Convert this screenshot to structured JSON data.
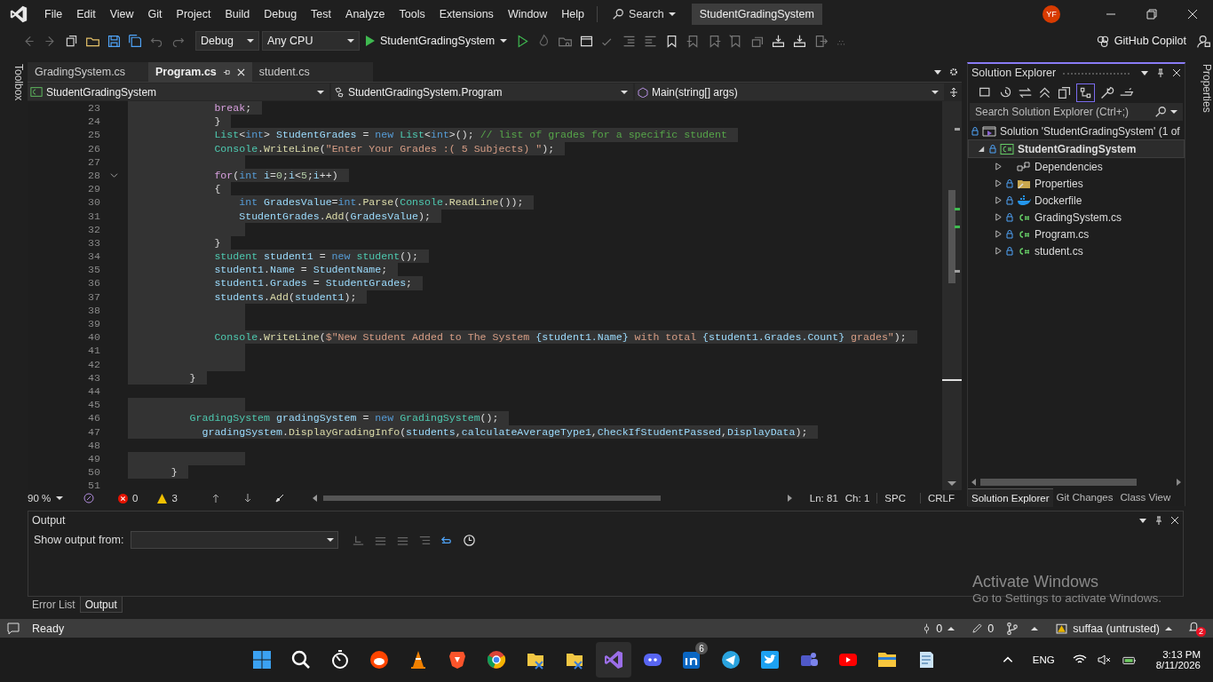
{
  "title_bar": {
    "menu": [
      "File",
      "Edit",
      "View",
      "Git",
      "Project",
      "Build",
      "Debug",
      "Test",
      "Analyze",
      "Tools",
      "Extensions",
      "Window",
      "Help"
    ],
    "search": "Search",
    "solution_title": "StudentGradingSystem",
    "avatar": "YF"
  },
  "toolbar": {
    "configuration": "Debug",
    "platform": "Any CPU",
    "start_target": "StudentGradingSystem",
    "copilot": "GitHub Copilot"
  },
  "side_tabs": {
    "left": "Toolbox",
    "right": "Properties"
  },
  "document_tabs": [
    {
      "label": "GradingSystem.cs",
      "selected": false
    },
    {
      "label": "Program.cs",
      "selected": true
    },
    {
      "label": "student.cs",
      "selected": false
    }
  ],
  "nav_bar": {
    "project": "StudentGradingSystem",
    "type": "StudentGradingSystem.Program",
    "member": "Main(string[] args)"
  },
  "code_lines": [
    {
      "num": "23",
      "fold": false,
      "selected": true,
      "tokens": [
        {
          "kind": "control",
          "text": "              break"
        },
        {
          "kind": "plain",
          "text": ";"
        }
      ]
    },
    {
      "num": "24",
      "fold": false,
      "selected": true,
      "tokens": [
        {
          "kind": "plain",
          "text": "              }"
        }
      ]
    },
    {
      "num": "25",
      "fold": false,
      "selected": true,
      "tokens": [
        {
          "kind": "type",
          "text": "              List"
        },
        {
          "kind": "plain",
          "text": "<"
        },
        {
          "kind": "keyword",
          "text": "int"
        },
        {
          "kind": "plain",
          "text": "> "
        },
        {
          "kind": "variable",
          "text": "StudentGrades"
        },
        {
          "kind": "plain",
          "text": " = "
        },
        {
          "kind": "keyword",
          "text": "new "
        },
        {
          "kind": "type",
          "text": "List"
        },
        {
          "kind": "plain",
          "text": "<"
        },
        {
          "kind": "keyword",
          "text": "int"
        },
        {
          "kind": "plain",
          "text": ">(); "
        },
        {
          "kind": "comment",
          "text": "// list of grades for a specific student"
        }
      ]
    },
    {
      "num": "26",
      "fold": false,
      "selected": true,
      "tokens": [
        {
          "kind": "type",
          "text": "              Console"
        },
        {
          "kind": "plain",
          "text": "."
        },
        {
          "kind": "method",
          "text": "WriteLine"
        },
        {
          "kind": "plain",
          "text": "("
        },
        {
          "kind": "string",
          "text": "\"Enter Your Grades :( 5 Subjects) \""
        },
        {
          "kind": "plain",
          "text": ");"
        }
      ]
    },
    {
      "num": "27",
      "fold": false,
      "selected": true
    },
    {
      "num": "28",
      "fold": true,
      "selected": true,
      "tokens": [
        {
          "kind": "control",
          "text": "              for"
        },
        {
          "kind": "plain",
          "text": "("
        },
        {
          "kind": "keyword",
          "text": "int "
        },
        {
          "kind": "variable",
          "text": "i"
        },
        {
          "kind": "plain",
          "text": "="
        },
        {
          "kind": "number",
          "text": "0"
        },
        {
          "kind": "plain",
          "text": ";"
        },
        {
          "kind": "variable",
          "text": "i"
        },
        {
          "kind": "plain",
          "text": "<"
        },
        {
          "kind": "number",
          "text": "5"
        },
        {
          "kind": "plain",
          "text": ";"
        },
        {
          "kind": "variable",
          "text": "i"
        },
        {
          "kind": "plain",
          "text": "++)"
        }
      ]
    },
    {
      "num": "29",
      "fold": false,
      "selected": true,
      "tokens": [
        {
          "kind": "plain",
          "text": "              {"
        }
      ]
    },
    {
      "num": "30",
      "fold": false,
      "selected": true,
      "tokens": [
        {
          "kind": "keyword",
          "text": "                  int "
        },
        {
          "kind": "variable",
          "text": "GradesValue"
        },
        {
          "kind": "plain",
          "text": "="
        },
        {
          "kind": "keyword",
          "text": "int"
        },
        {
          "kind": "plain",
          "text": "."
        },
        {
          "kind": "method",
          "text": "Parse"
        },
        {
          "kind": "plain",
          "text": "("
        },
        {
          "kind": "type",
          "text": "Console"
        },
        {
          "kind": "plain",
          "text": "."
        },
        {
          "kind": "method",
          "text": "ReadLine"
        },
        {
          "kind": "plain",
          "text": "());"
        }
      ]
    },
    {
      "num": "31",
      "fold": false,
      "selected": true,
      "tokens": [
        {
          "kind": "variable",
          "text": "                  StudentGrades"
        },
        {
          "kind": "plain",
          "text": "."
        },
        {
          "kind": "method",
          "text": "Add"
        },
        {
          "kind": "plain",
          "text": "("
        },
        {
          "kind": "variable",
          "text": "GradesValue"
        },
        {
          "kind": "plain",
          "text": ");"
        }
      ]
    },
    {
      "num": "32",
      "fold": false,
      "selected": true
    },
    {
      "num": "33",
      "fold": false,
      "selected": true,
      "tokens": [
        {
          "kind": "plain",
          "text": "              }"
        }
      ]
    },
    {
      "num": "34",
      "fold": false,
      "selected": true,
      "tokens": [
        {
          "kind": "type",
          "text": "              student "
        },
        {
          "kind": "variable",
          "text": "student1"
        },
        {
          "kind": "plain",
          "text": " = "
        },
        {
          "kind": "keyword",
          "text": "new "
        },
        {
          "kind": "type",
          "text": "student"
        },
        {
          "kind": "plain",
          "text": "();"
        }
      ]
    },
    {
      "num": "35",
      "fold": false,
      "selected": true,
      "tokens": [
        {
          "kind": "variable",
          "text": "              student1"
        },
        {
          "kind": "plain",
          "text": "."
        },
        {
          "kind": "variable",
          "text": "Name"
        },
        {
          "kind": "plain",
          "text": " = "
        },
        {
          "kind": "variable",
          "text": "StudentName"
        },
        {
          "kind": "plain",
          "text": ";"
        }
      ]
    },
    {
      "num": "36",
      "fold": false,
      "selected": true,
      "tokens": [
        {
          "kind": "variable",
          "text": "              student1"
        },
        {
          "kind": "plain",
          "text": "."
        },
        {
          "kind": "variable",
          "text": "Grades"
        },
        {
          "kind": "plain",
          "text": " = "
        },
        {
          "kind": "variable",
          "text": "StudentGrades"
        },
        {
          "kind": "plain",
          "text": ";"
        }
      ]
    },
    {
      "num": "37",
      "fold": false,
      "selected": true,
      "tokens": [
        {
          "kind": "variable",
          "text": "              students"
        },
        {
          "kind": "plain",
          "text": "."
        },
        {
          "kind": "method",
          "text": "Add"
        },
        {
          "kind": "plain",
          "text": "("
        },
        {
          "kind": "variable",
          "text": "student1"
        },
        {
          "kind": "plain",
          "text": ");"
        }
      ]
    },
    {
      "num": "38",
      "fold": false,
      "selected": true
    },
    {
      "num": "39",
      "fold": false,
      "selected": true
    },
    {
      "num": "40",
      "fold": false,
      "selected": true,
      "tokens": [
        {
          "kind": "type",
          "text": "              Console"
        },
        {
          "kind": "plain",
          "text": "."
        },
        {
          "kind": "method",
          "text": "WriteLine"
        },
        {
          "kind": "plain",
          "text": "("
        },
        {
          "kind": "string",
          "text": "$\"New Student Added to The System "
        },
        {
          "kind": "variable",
          "text": "{student1.Name}"
        },
        {
          "kind": "string",
          "text": " with total "
        },
        {
          "kind": "variable",
          "text": "{student1.Grades.Count}"
        },
        {
          "kind": "string",
          "text": " grades\""
        },
        {
          "kind": "plain",
          "text": ");"
        }
      ]
    },
    {
      "num": "41",
      "fold": false,
      "selected": true
    },
    {
      "num": "42",
      "fold": false,
      "selected": true
    },
    {
      "num": "43",
      "fold": false,
      "selected": true,
      "tokens": [
        {
          "kind": "plain",
          "text": "          }"
        }
      ]
    },
    {
      "num": "44",
      "fold": false,
      "selected": false
    },
    {
      "num": "45",
      "fold": false,
      "selected": true
    },
    {
      "num": "46",
      "fold": false,
      "selected": true,
      "tokens": [
        {
          "kind": "type",
          "text": "          GradingSystem "
        },
        {
          "kind": "variable",
          "text": "gradingSystem"
        },
        {
          "kind": "plain",
          "text": " = "
        },
        {
          "kind": "keyword",
          "text": "new "
        },
        {
          "kind": "type",
          "text": "GradingSystem"
        },
        {
          "kind": "plain",
          "text": "();"
        }
      ]
    },
    {
      "num": "47",
      "fold": false,
      "selected": true,
      "tokens": [
        {
          "kind": "variable",
          "text": "            gradingSystem"
        },
        {
          "kind": "plain",
          "text": "."
        },
        {
          "kind": "method",
          "text": "DisplayGradingInfo"
        },
        {
          "kind": "plain",
          "text": "("
        },
        {
          "kind": "variable",
          "text": "students"
        },
        {
          "kind": "plain",
          "text": ","
        },
        {
          "kind": "variable",
          "text": "calculateAverageType1"
        },
        {
          "kind": "plain",
          "text": ","
        },
        {
          "kind": "variable",
          "text": "CheckIfStudentPassed"
        },
        {
          "kind": "plain",
          "text": ","
        },
        {
          "kind": "variable",
          "text": "DisplayData"
        },
        {
          "kind": "plain",
          "text": ");"
        }
      ]
    },
    {
      "num": "48",
      "fold": false,
      "selected": false
    },
    {
      "num": "49",
      "fold": false,
      "selected": true
    },
    {
      "num": "50",
      "fold": false,
      "selected": true,
      "tokens": [
        {
          "kind": "plain",
          "text": "       }"
        }
      ]
    },
    {
      "num": "51",
      "fold": false,
      "selected": false
    }
  ],
  "editor_status": {
    "zoom": "90 %",
    "errors": "0",
    "warnings": "3",
    "line": "Ln: 81",
    "column": "Ch: 1",
    "whitespace": "SPC",
    "line_endings": "CRLF"
  },
  "solution_explorer": {
    "title": "Solution Explorer",
    "search_placeholder": "Search Solution Explorer (Ctrl+;)",
    "solution": "Solution 'StudentGradingSystem' (1 of",
    "project": {
      "label": "StudentGradingSystem",
      "expanded": true
    },
    "items": [
      {
        "label": "Dependencies",
        "kind": "dependencies",
        "locked": false,
        "expanded": false
      },
      {
        "label": "Properties",
        "kind": "folder",
        "locked": true,
        "expanded": false
      },
      {
        "label": "Dockerfile",
        "kind": "docker",
        "locked": true,
        "expanded": false
      },
      {
        "label": "GradingSystem.cs",
        "kind": "csharp",
        "locked": true,
        "expanded": false
      },
      {
        "label": "Program.cs",
        "kind": "csharp",
        "locked": true,
        "expanded": false
      },
      {
        "label": "student.cs",
        "kind": "csharp",
        "locked": true,
        "expanded": false
      }
    ],
    "tabs": [
      {
        "label": "Solution Explorer",
        "selected": true
      },
      {
        "label": "Git Changes",
        "selected": false
      },
      {
        "label": "Class View",
        "selected": false
      }
    ]
  },
  "output": {
    "title": "Output",
    "show_from_label": "Show output from:",
    "tabs": [
      {
        "label": "Error List",
        "selected": false
      },
      {
        "label": "Output",
        "selected": true
      }
    ]
  },
  "activation": {
    "title": "Activate Windows",
    "subtitle": "Go to Settings to activate Windows."
  },
  "status_bar": {
    "text": "Ready",
    "push_count": "0",
    "changes_count": "0",
    "repo": "suffaa (untrusted)",
    "notifications": "2"
  },
  "taskbar": {
    "apps": [
      {
        "kind": "start"
      },
      {
        "kind": "search"
      },
      {
        "kind": "timer"
      },
      {
        "kind": "reddit"
      },
      {
        "kind": "cone"
      },
      {
        "kind": "lion"
      },
      {
        "kind": "chrome"
      },
      {
        "kind": "sync-folder"
      },
      {
        "kind": "sync-folder"
      },
      {
        "kind": "vs"
      },
      {
        "kind": "discord"
      },
      {
        "kind": "linkedin",
        "badge": "6"
      },
      {
        "kind": "telegram"
      },
      {
        "kind": "twitter"
      },
      {
        "kind": "teams"
      },
      {
        "kind": "youtube"
      },
      {
        "kind": "explorer"
      },
      {
        "kind": "notes"
      }
    ],
    "language": "ENG",
    "time": "3:13 PM",
    "date": "8/11/2026"
  }
}
